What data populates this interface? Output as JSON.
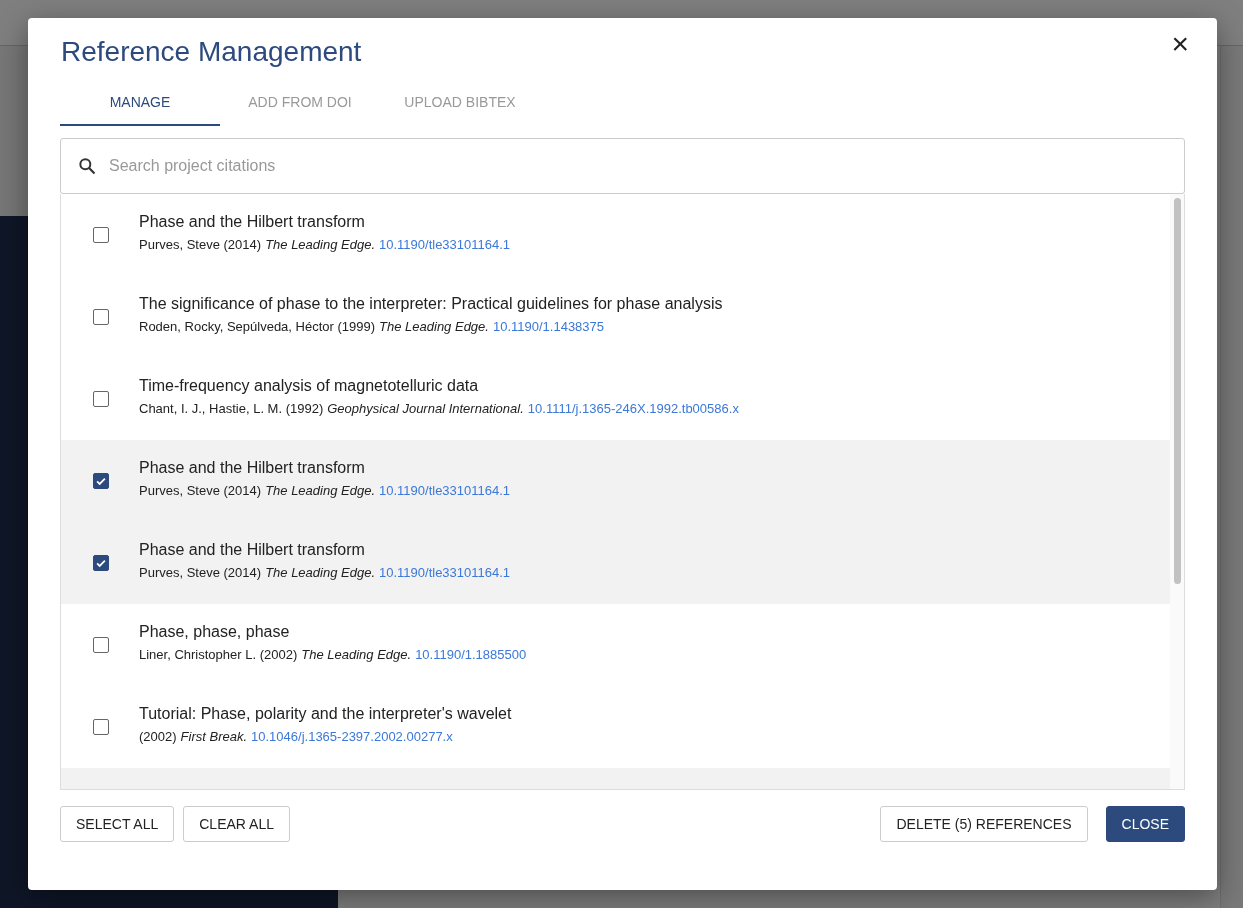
{
  "dialog": {
    "title": "Reference Management",
    "close_icon": "×"
  },
  "tabs": [
    {
      "label": "MANAGE",
      "selected": true
    },
    {
      "label": "ADD FROM DOI",
      "selected": false
    },
    {
      "label": "UPLOAD BIBTEX",
      "selected": false
    }
  ],
  "search": {
    "placeholder": "Search project citations"
  },
  "references": [
    {
      "title": "Phase and the Hilbert transform",
      "authors": "Purves, Steve (2014)",
      "journal": "The Leading Edge.",
      "doi": "10.1190/tle33101164.1",
      "selected": false
    },
    {
      "title": "The significance of phase to the interpreter: Practical guidelines for phase analysis",
      "authors": "Roden, Rocky, Sepúlveda, Héctor (1999)",
      "journal": "The Leading Edge.",
      "doi": "10.1190/1.1438375",
      "selected": false
    },
    {
      "title": "Time-frequency analysis of magnetotelluric data",
      "authors": "Chant, I. J., Hastie, L. M. (1992)",
      "journal": "Geophysical Journal International.",
      "doi": "10.1111/j.1365-246X.1992.tb00586.x",
      "selected": false
    },
    {
      "title": "Phase and the Hilbert transform",
      "authors": "Purves, Steve (2014)",
      "journal": "The Leading Edge.",
      "doi": "10.1190/tle33101164.1",
      "selected": true
    },
    {
      "title": "Phase and the Hilbert transform",
      "authors": "Purves, Steve (2014)",
      "journal": "The Leading Edge.",
      "doi": "10.1190/tle33101164.1",
      "selected": true
    },
    {
      "title": "Phase, phase, phase",
      "authors": "Liner, Christopher L. (2002)",
      "journal": "The Leading Edge.",
      "doi": "10.1190/1.1885500",
      "selected": false
    },
    {
      "title": "Tutorial: Phase, polarity and the interpreter's wavelet",
      "authors": "(2002)",
      "journal": "First Break.",
      "doi": "10.1046/j.1365-2397.2002.00277.x",
      "selected": false
    }
  ],
  "buttons": [
    {
      "label": "SELECT ALL",
      "kind": "outline"
    },
    {
      "label": "CLEAR ALL",
      "kind": "outline"
    },
    {
      "label": "DELETE (5) REFERENCES",
      "kind": "outline"
    },
    {
      "label": "CLOSE",
      "kind": "primary"
    }
  ]
}
